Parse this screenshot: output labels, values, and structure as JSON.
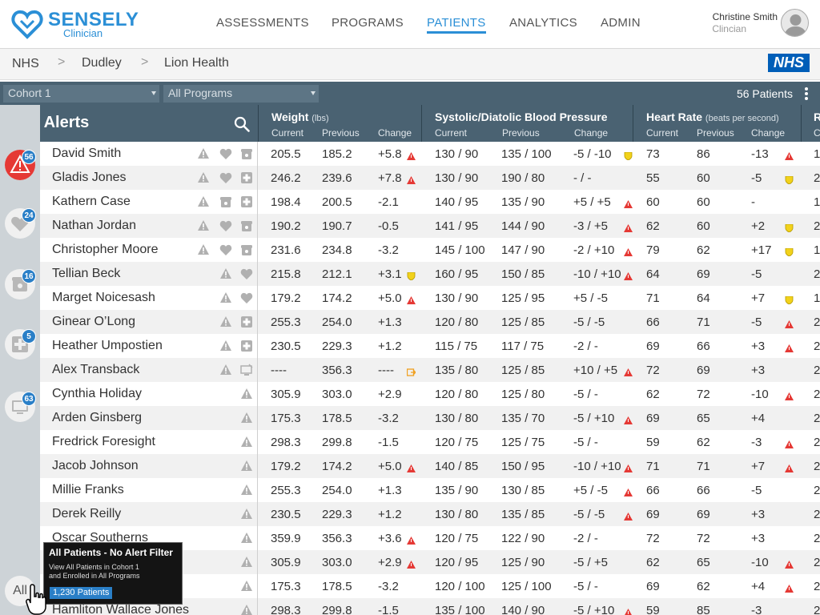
{
  "app": {
    "brand": "SENSELY",
    "brand_sub": "Clinician",
    "nav": [
      {
        "label": "ASSESSMENTS",
        "active": false
      },
      {
        "label": "PROGRAMS",
        "active": false
      },
      {
        "label": "PATIENTS",
        "active": true
      },
      {
        "label": "ANALYTICS",
        "active": false
      },
      {
        "label": "ADMIN",
        "active": false
      }
    ],
    "user": {
      "name": "Christine Smith",
      "role": "Clincian"
    }
  },
  "breadcrumb": [
    "NHS",
    "Dudley",
    "Lion Health"
  ],
  "breadcrumb_sep": ">",
  "nhs_logo": "NHS",
  "filters": {
    "cohort": "Cohort 1",
    "program": "All Programs",
    "patient_count": "56 Patients"
  },
  "list": {
    "title": "Red Alerts"
  },
  "rail": {
    "buttons": [
      {
        "icon": "alert-triangle-icon",
        "count": "56"
      },
      {
        "icon": "heart-icon",
        "count": "24"
      },
      {
        "icon": "phone-icon",
        "count": "16"
      },
      {
        "icon": "medical-cross-icon",
        "count": "5"
      },
      {
        "icon": "device-icon",
        "count": "63"
      }
    ],
    "all_label": "All"
  },
  "columns": {
    "weight": {
      "title": "Weight",
      "unit": "(lbs)"
    },
    "bp": {
      "title": "Systolic/Diatolic Blood Pressure",
      "unit": ""
    },
    "hr": {
      "title": "Heart Rate",
      "unit": "(beats per second)"
    },
    "next_partial": "R",
    "sub": [
      "Current",
      "Previous",
      "Change"
    ],
    "next_sub_partial": "C"
  },
  "colors": {
    "header": "#4a6272",
    "accent": "#2b8fd6",
    "red_flag": "#e53935",
    "yellow_flag": "#f2d21b",
    "orange_flag": "#f0a020"
  },
  "rows": [
    {
      "name": "David Smith",
      "icons": [
        "alert",
        "heart",
        "phone"
      ],
      "w": [
        "205.5",
        "185.2",
        "+5.8"
      ],
      "wf": "red",
      "bp": [
        "130 / 90",
        "135 / 100",
        "-5 / -10"
      ],
      "bpf": "yellow",
      "hr": [
        "73",
        "86",
        "-13"
      ],
      "hrf": "red",
      "next": "1"
    },
    {
      "name": "Gladis Jones",
      "icons": [
        "alert",
        "heart",
        "cross"
      ],
      "w": [
        "246.2",
        "239.6",
        "+7.8"
      ],
      "wf": "red",
      "bp": [
        "130 / 90",
        "190 / 80",
        " - / -"
      ],
      "bpf": "",
      "hr": [
        "55",
        "60",
        "-5"
      ],
      "hrf": "yellow",
      "next": "2"
    },
    {
      "name": "Kathern Case",
      "icons": [
        "alert",
        "phone",
        "cross"
      ],
      "w": [
        "198.4",
        "200.5",
        "-2.1"
      ],
      "wf": "",
      "bp": [
        "140 / 95",
        "135 / 90",
        "+5 / +5"
      ],
      "bpf": "red",
      "hr": [
        "60",
        "60",
        "-"
      ],
      "hrf": "",
      "next": "1"
    },
    {
      "name": "Nathan Jordan",
      "icons": [
        "alert",
        "heart",
        "phone"
      ],
      "w": [
        "190.2",
        "190.7",
        "-0.5"
      ],
      "wf": "",
      "bp": [
        "141 / 95",
        "144 / 90",
        "-3 / +5"
      ],
      "bpf": "red",
      "hr": [
        "62",
        "60",
        "+2"
      ],
      "hrf": "yellow",
      "next": "2"
    },
    {
      "name": "Christopher Moore",
      "icons": [
        "alert",
        "heart",
        "phone"
      ],
      "w": [
        "231.6",
        "234.8",
        "-3.2"
      ],
      "wf": "",
      "bp": [
        "145 / 100",
        "147 / 90",
        "-2 / +10"
      ],
      "bpf": "red",
      "hr": [
        "79",
        "62",
        "+17"
      ],
      "hrf": "yellow",
      "next": "1"
    },
    {
      "name": "Tellian Beck",
      "icons": [
        "alert",
        "heart"
      ],
      "w": [
        "215.8",
        "212.1",
        "+3.1"
      ],
      "wf": "yellow",
      "bp": [
        "160 / 95",
        "150 / 85",
        "-10 / +10"
      ],
      "bpf": "red",
      "hr": [
        "64",
        "69",
        "-5"
      ],
      "hrf": "",
      "next": "2"
    },
    {
      "name": "Marget Noicesash",
      "icons": [
        "alert",
        "heart"
      ],
      "w": [
        "179.2",
        "174.2",
        "+5.0"
      ],
      "wf": "red",
      "bp": [
        "130 / 90",
        "125 / 95",
        "+5 / -5"
      ],
      "bpf": "",
      "hr": [
        "71",
        "64",
        "+7"
      ],
      "hrf": "yellow",
      "next": "1"
    },
    {
      "name": "Ginear O’Long",
      "icons": [
        "alert",
        "cross"
      ],
      "w": [
        "255.3",
        "254.0",
        "+1.3"
      ],
      "wf": "",
      "bp": [
        "120 / 80",
        "125 / 85",
        "-5 / -5"
      ],
      "bpf": "",
      "hr": [
        "66",
        "71",
        "-5"
      ],
      "hrf": "red",
      "next": "2"
    },
    {
      "name": "Heather Umpostien",
      "icons": [
        "alert",
        "cross"
      ],
      "w": [
        "230.5",
        "229.3",
        "+1.2"
      ],
      "wf": "",
      "bp": [
        "115 / 75",
        "117 / 75",
        "-2 / -"
      ],
      "bpf": "",
      "hr": [
        "69",
        "66",
        "+3"
      ],
      "hrf": "red",
      "next": "2"
    },
    {
      "name": "Alex Transback",
      "icons": [
        "alert",
        "device"
      ],
      "w": [
        "----",
        "356.3",
        "----"
      ],
      "wf": "orange",
      "bp": [
        "135 / 80",
        "125 / 85",
        "+10 / +5"
      ],
      "bpf": "red",
      "hr": [
        "72",
        "69",
        "+3"
      ],
      "hrf": "",
      "next": "2"
    },
    {
      "name": "Cynthia Holiday",
      "icons": [
        "alert"
      ],
      "w": [
        "305.9",
        "303.0",
        "+2.9"
      ],
      "wf": "",
      "bp": [
        "120 / 80",
        "125 / 80",
        "-5 / -"
      ],
      "bpf": "",
      "hr": [
        "62",
        "72",
        "-10"
      ],
      "hrf": "red",
      "next": "2"
    },
    {
      "name": "Arden Ginsberg",
      "icons": [
        "alert"
      ],
      "w": [
        "175.3",
        "178.5",
        "-3.2"
      ],
      "wf": "",
      "bp": [
        "130 / 80",
        "135 / 70",
        "-5 / +10"
      ],
      "bpf": "red",
      "hr": [
        "69",
        "65",
        "+4"
      ],
      "hrf": "",
      "next": "2"
    },
    {
      "name": "Fredrick Foresight",
      "icons": [
        "alert"
      ],
      "w": [
        "298.3",
        "299.8",
        "-1.5"
      ],
      "wf": "",
      "bp": [
        "120 / 75",
        "125 / 75",
        "-5 / -"
      ],
      "bpf": "",
      "hr": [
        "59",
        "62",
        "-3"
      ],
      "hrf": "red",
      "next": "2"
    },
    {
      "name": "Jacob Johnson",
      "icons": [
        "alert"
      ],
      "w": [
        "179.2",
        "174.2",
        "+5.0"
      ],
      "wf": "red",
      "bp": [
        "140 / 85",
        "150 / 95",
        "-10 / +10"
      ],
      "bpf": "red",
      "hr": [
        "71",
        "71",
        "+7"
      ],
      "hrf": "red",
      "next": "2"
    },
    {
      "name": "Millie Franks",
      "icons": [
        "alert"
      ],
      "w": [
        "255.3",
        "254.0",
        "+1.3"
      ],
      "wf": "",
      "bp": [
        "135 / 90",
        "130 / 85",
        "+5 / -5"
      ],
      "bpf": "red",
      "hr": [
        "66",
        "66",
        "-5"
      ],
      "hrf": "",
      "next": "2"
    },
    {
      "name": "Derek Reilly",
      "icons": [
        "alert"
      ],
      "w": [
        "230.5",
        "229.3",
        "+1.2"
      ],
      "wf": "",
      "bp": [
        "130 / 80",
        "135 / 85",
        "-5 / -5"
      ],
      "bpf": "red",
      "hr": [
        "69",
        "69",
        "+3"
      ],
      "hrf": "",
      "next": "2"
    },
    {
      "name": "Oscar Southerns",
      "icons": [
        "alert"
      ],
      "w": [
        "359.9",
        "356.3",
        "+3.6"
      ],
      "wf": "red",
      "bp": [
        "120 / 75",
        "122 / 90",
        "-2 / -"
      ],
      "bpf": "",
      "hr": [
        "72",
        "72",
        "+3"
      ],
      "hrf": "",
      "next": "2"
    },
    {
      "name": "",
      "icons": [
        "alert"
      ],
      "w": [
        "305.9",
        "303.0",
        "+2.9"
      ],
      "wf": "red",
      "bp": [
        "120 / 95",
        "125 / 90",
        "-5 / +5"
      ],
      "bpf": "",
      "hr": [
        "62",
        "65",
        "-10"
      ],
      "hrf": "red",
      "next": "2"
    },
    {
      "name": "",
      "icons": [
        "alert"
      ],
      "w": [
        "175.3",
        "178.5",
        "-3.2"
      ],
      "wf": "",
      "bp": [
        "120 / 100",
        "125 / 100",
        "-5 / -"
      ],
      "bpf": "",
      "hr": [
        "69",
        "62",
        "+4"
      ],
      "hrf": "red",
      "next": "2"
    },
    {
      "name": "Hamliton Wallace Jones",
      "icons": [
        "alert"
      ],
      "w": [
        "298.3",
        "299.8",
        "-1.5"
      ],
      "wf": "",
      "bp": [
        "135 / 100",
        "140 / 90",
        "-5 / +10"
      ],
      "bpf": "red",
      "hr": [
        "59",
        "85",
        "-3"
      ],
      "hrf": "",
      "next": "2"
    }
  ],
  "tooltip": {
    "title": "All Patients - No Alert Filter",
    "desc_line1": "View All Patients in Cohort 1",
    "desc_line2": "and Enrolled in All Programs",
    "button": "1,230 Patients"
  }
}
